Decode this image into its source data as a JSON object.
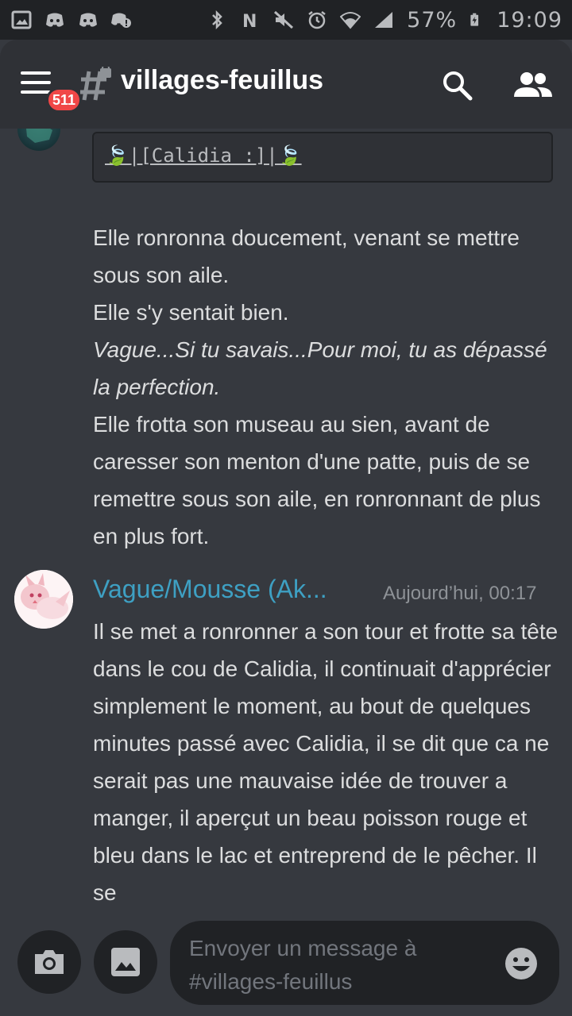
{
  "status_bar": {
    "battery": "57%",
    "time": "19:09"
  },
  "header": {
    "notification_count": "511",
    "channel_name": "villages-feuillus"
  },
  "messages": {
    "first": {
      "code_block": "🍃|[Calidia :]|🍃",
      "lines": [
        {
          "text": "Elle ronronna doucement, venant se mettre sous son aile.",
          "italic": false
        },
        {
          "text": "Elle s'y sentait bien.",
          "italic": false
        },
        {
          "text": "Vague...Si tu savais...Pour moi, tu as dépassé la perfection.",
          "italic": true
        },
        {
          "text": "Elle frotta son museau au sien, avant de caresser son menton d'une patte, puis de se remettre sous son aile, en ronronnant de plus en plus fort.",
          "italic": false
        }
      ]
    },
    "second": {
      "author": "Vague/Mousse (Ak...",
      "timestamp": "Aujourd’hui, 00:17",
      "text": "Il se met a ronronner a son tour et frotte sa tête dans le cou de Calidia, il continuait d'apprécier simplement le moment, au bout de quelques minutes passé avec Calidia, il se dit que ca ne serait pas une mauvaise idée de trouver a manger, il aperçut un beau poisson rouge et bleu dans le lac et entreprend de le pêcher. Il se"
    }
  },
  "composer": {
    "placeholder": "Envoyer un message à #villages-feuillus"
  },
  "colors": {
    "background": "#36393f",
    "header": "#2f3136",
    "input": "#202225",
    "author": "#3ea0c3",
    "badge": "#f04747"
  }
}
